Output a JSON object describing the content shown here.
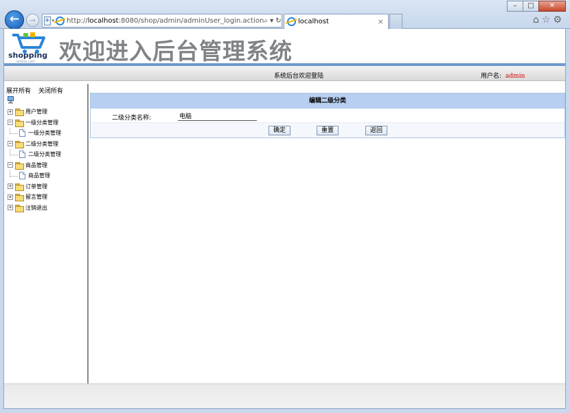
{
  "browser": {
    "url_prefix": "http://",
    "url_host": "localhost",
    "url_rest": ":8080/shop/admin/adminUser_login.action",
    "address_tools": "⌕ ▾ ↻",
    "tab_title": "localhost",
    "tab_close": "×",
    "back_glyph": "←",
    "forward_glyph": "→",
    "compat_glyph": "+",
    "dropdown_glyph": "▾",
    "window_buttons": {
      "minimize": "–",
      "maximize": "□",
      "close": "✕"
    },
    "right_icons": "⌂☆⚙"
  },
  "banner": {
    "logo_text": "shopping",
    "logo_sub": "online cart",
    "title": "欢迎进入后台管理系统"
  },
  "topbar": {
    "welcome": "系统后台欢迎登陆",
    "user_label": "用户名:",
    "user_name": "admin"
  },
  "sidebar": {
    "expand_all": "展开所有",
    "collapse_all": "关闭所有",
    "tree": [
      {
        "id": "user",
        "label": "用户管理",
        "expanded": false,
        "sign": "+"
      },
      {
        "id": "cat1",
        "label": "一级分类管理",
        "expanded": true,
        "sign": "−",
        "children": [
          {
            "id": "cat1-manage",
            "label": "一级分类管理"
          }
        ]
      },
      {
        "id": "cat2",
        "label": "二级分类管理",
        "expanded": true,
        "sign": "−",
        "children": [
          {
            "id": "cat2-manage",
            "label": "二级分类管理"
          }
        ]
      },
      {
        "id": "product",
        "label": "商品管理",
        "expanded": true,
        "sign": "−",
        "children": [
          {
            "id": "product-manage",
            "label": "商品管理"
          }
        ]
      },
      {
        "id": "order",
        "label": "订单管理",
        "expanded": false,
        "sign": "+"
      },
      {
        "id": "message",
        "label": "留言管理",
        "expanded": false,
        "sign": "+"
      },
      {
        "id": "logout",
        "label": "注销退出",
        "expanded": false,
        "sign": "+"
      }
    ]
  },
  "form": {
    "title": "编辑二级分类",
    "field_label": "二级分类名称:",
    "field_value": "电脑",
    "confirm_label": "确定",
    "reset_label": "重置",
    "back_label": "返回"
  },
  "colors": {
    "accent": "#6d98cb",
    "form_header": "#b7cff0",
    "username": "#d40000"
  }
}
